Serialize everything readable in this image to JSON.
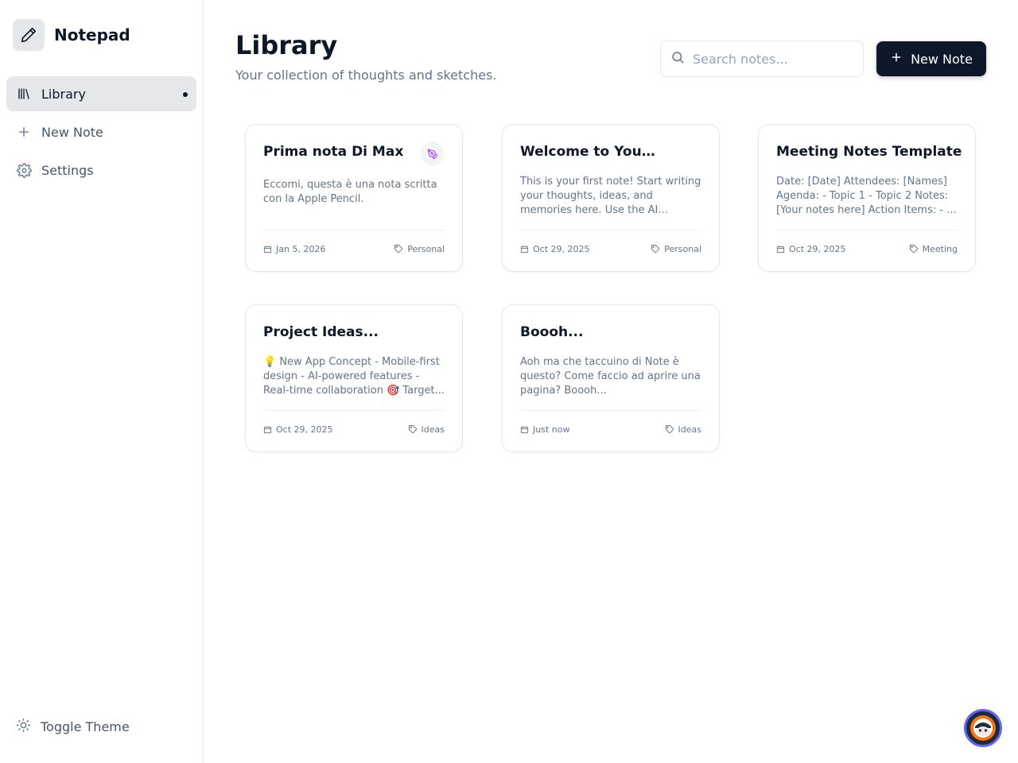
{
  "app": {
    "name": "Notepad"
  },
  "sidebar": {
    "items": [
      {
        "label": "Library"
      },
      {
        "label": "New Note"
      },
      {
        "label": "Settings"
      }
    ],
    "toggle_theme_label": "Toggle Theme"
  },
  "header": {
    "title": "Library",
    "subtitle": "Your collection of thoughts and sketches.",
    "search_placeholder": "Search notes...",
    "new_note_label": "New Note"
  },
  "notes": [
    {
      "title": "Prima nota Di Max",
      "preview": "Eccomi, questa è una nota scritta con la Apple Pencil.",
      "date": "Jan 5, 2026",
      "tag": "Personal",
      "has_drawing": true
    },
    {
      "title": "Welcome to Your Notepad",
      "preview": "This is your first note! Start writing your thoughts, ideas, and memories here. Use the AI assistant to help you write.",
      "date": "Oct 29, 2025",
      "tag": "Personal"
    },
    {
      "title": "Meeting Notes Template",
      "preview": "Date: [Date] Attendees: [Names] Agenda: - Topic 1 - Topic 2 Notes: [Your notes here] Action Items: - ...",
      "date": "Oct 29, 2025",
      "tag": "Meeting"
    },
    {
      "title": "Project Ideas...",
      "preview": "💡 New App Concept - Mobile-first design - AI-powered features - Real-time collaboration 🎯 Target...",
      "date": "Oct 29, 2025",
      "tag": "Ideas"
    },
    {
      "title": "Boooh...",
      "preview": "Aoh ma che taccuino di Note è questo? Come faccio ad aprire una pagina? Boooh...",
      "date": "Just now",
      "tag": "Ideas"
    }
  ],
  "colors": {
    "primary": "#0f172a",
    "muted": "#64748b",
    "accent_badge": "#a855f7"
  },
  "icons": {
    "brand": "pencil-icon",
    "library": "library-icon",
    "new_note": "plus-icon",
    "settings": "gear-icon",
    "theme": "sun-icon",
    "search": "search-icon",
    "date": "calendar-icon",
    "tag": "tag-icon",
    "drawing": "pen-nib-icon"
  }
}
